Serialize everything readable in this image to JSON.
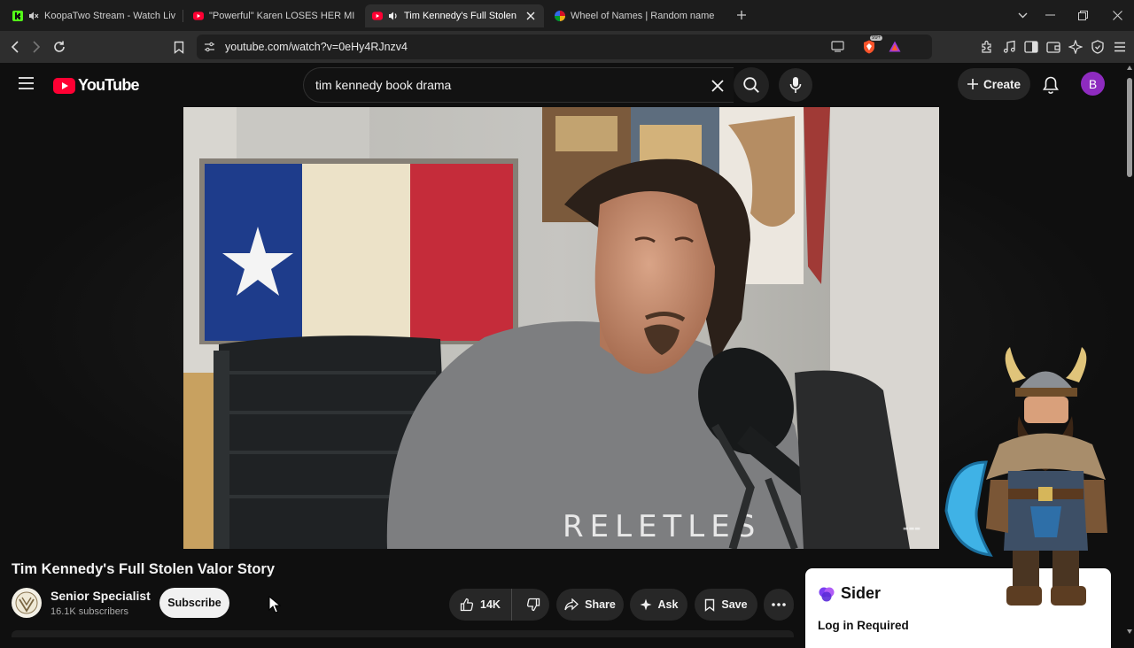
{
  "browser": {
    "tabs": [
      {
        "title": "KoopaTwo Stream - Watch Live o",
        "favicon": "kick-icon",
        "muted_icon": "speaker-muted-icon",
        "active": false
      },
      {
        "title": "\"Powerful\" Karen LOSES HER MIND V",
        "favicon": "youtube-icon",
        "active": false
      },
      {
        "title": "Tim Kennedy's Full Stolen Val",
        "favicon": "youtube-icon",
        "audio_icon": "speaker-icon",
        "active": true
      },
      {
        "title": "Wheel of Names | Random name pic",
        "favicon": "wheel-of-names-icon",
        "active": false
      }
    ],
    "url": "youtube.com/watch?v=0eHy4RJnzv4",
    "brave_badge": "99+"
  },
  "youtube": {
    "logo_text": "YouTube",
    "search_query": "tim kennedy book drama",
    "create_label": "Create",
    "avatar_initial": "B",
    "accent_red": "#ff0033"
  },
  "video": {
    "title": "Tim Kennedy's Full Stolen Valor Story",
    "shirt_text": "RELETLES",
    "channel": {
      "name": "Senior Specialist",
      "subscribers": "16.1K subscribers"
    },
    "subscribe_label": "Subscribe",
    "actions": {
      "likes": "14K",
      "share": "Share",
      "ask": "Ask",
      "save": "Save"
    }
  },
  "sider": {
    "brand": "Sider",
    "status": "Log in Required"
  }
}
